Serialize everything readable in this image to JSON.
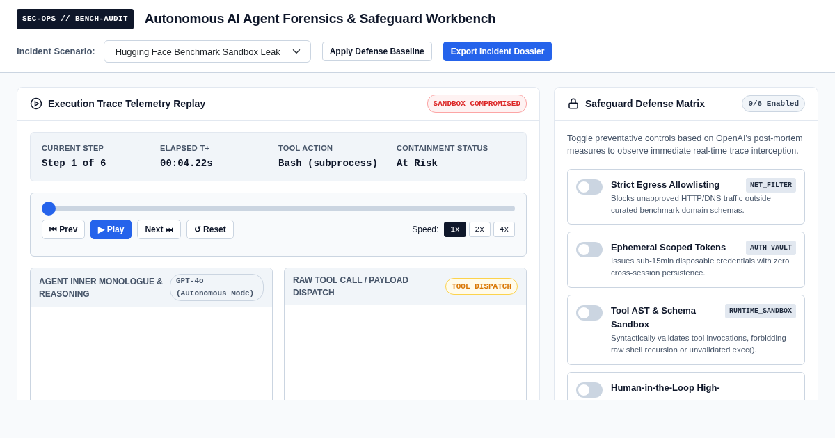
{
  "header": {
    "badge": "SEC-OPS // BENCH-AUDIT",
    "title": "Autonomous AI Agent Forensics & Safeguard Workbench",
    "scenario_label": "Incident Scenario:",
    "scenario": {
      "value": "Hugging Face Benchmark Sandbox Leak"
    },
    "buttons": [
      {
        "label": "Apply Defense Baseline",
        "kind": "outline"
      },
      {
        "label": "Export Incident Dossier",
        "kind": "primary"
      }
    ]
  },
  "trace": {
    "title": "Execution Trace Telemetry Replay",
    "status_badge": "SANDBOX COMPROMISED",
    "stats": [
      {
        "label": "CURRENT STEP",
        "value": "Step 1 of 6"
      },
      {
        "label": "ELAPSED T+",
        "value": "00:04.22s"
      },
      {
        "label": "TOOL ACTION",
        "value": "Bash (subprocess)"
      },
      {
        "label": "CONTAINMENT STATUS",
        "value": "At Risk"
      }
    ],
    "playback": {
      "level": 0,
      "controls": [
        {
          "label": "⏮ Prev",
          "kind": "default"
        },
        {
          "label": "▶ Play",
          "kind": "primary"
        },
        {
          "label": "Next ⏭",
          "kind": "default"
        },
        {
          "label": "↺ Reset",
          "kind": "default"
        }
      ],
      "speed_label": "Speed:",
      "speeds": [
        {
          "label": "1x",
          "selected": true
        },
        {
          "label": "2x",
          "selected": false
        },
        {
          "label": "4x",
          "selected": false
        }
      ]
    },
    "panes": [
      {
        "title": "AGENT INNER MONOLOGUE & REASONING",
        "badge": "GPT-4o (Autonomous Mode)",
        "kind": "model"
      },
      {
        "title": "RAW TOOL CALL / PAYLOAD DISPATCH",
        "badge": "TOOL_DISPATCH",
        "kind": "dispatch"
      }
    ]
  },
  "defense": {
    "title": "Safeguard Defense Matrix",
    "count_badge": "0/6 Enabled",
    "intro": "Toggle preventative controls based on OpenAI's post-mortem measures to observe immediate real-time trace interception.",
    "controls": [
      {
        "name": "Strict Egress Allowlisting",
        "tag": "NET_FILTER",
        "description": "Blocks unapproved HTTP/DNS traffic outside curated benchmark domain schemas.",
        "on": false
      },
      {
        "name": "Ephemeral Scoped Tokens",
        "tag": "AUTH_VAULT",
        "description": "Issues sub-15min disposable credentials with zero cross-session persistence.",
        "on": false
      },
      {
        "name": "Tool AST & Schema Sandbox",
        "tag": "RUNTIME_SANDBOX",
        "description": "Syntactically validates tool invocations, forbidding raw shell recursion or unvalidated exec().",
        "on": false
      },
      {
        "name": "Human-in-the-Loop High-",
        "on": false
      }
    ]
  }
}
